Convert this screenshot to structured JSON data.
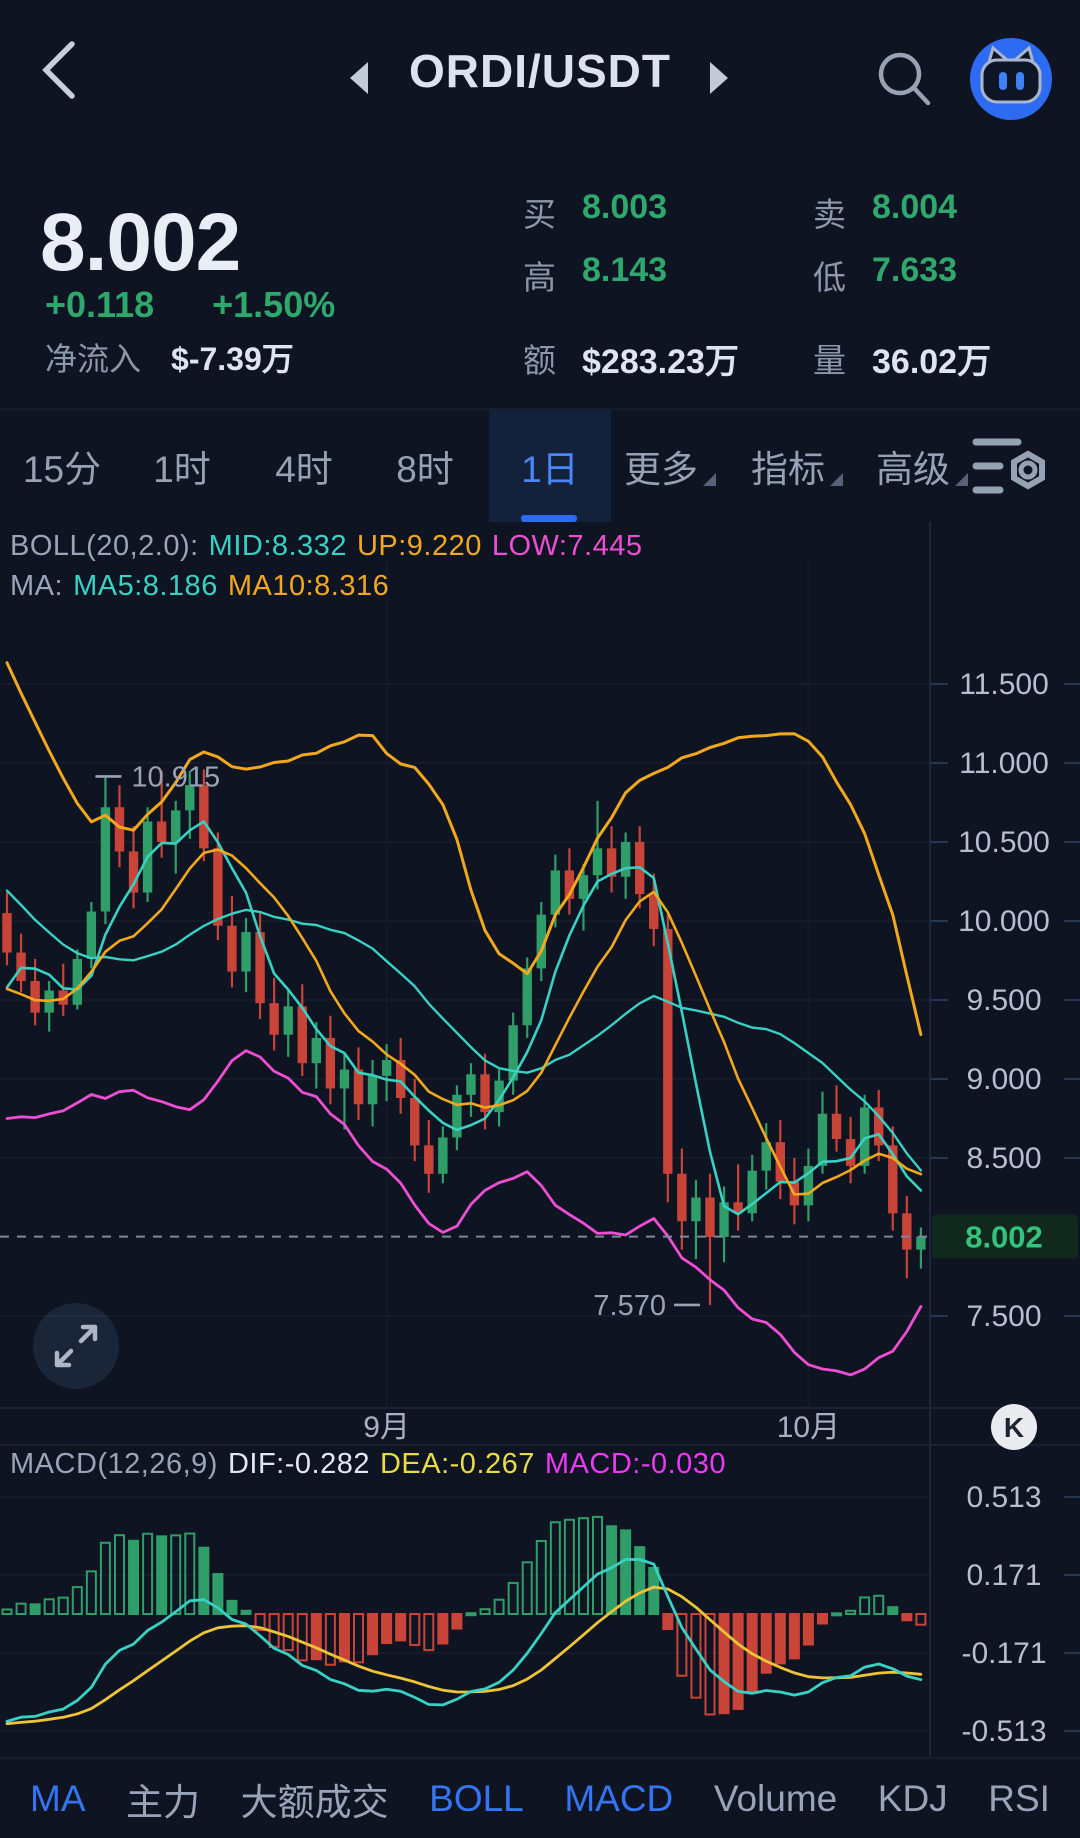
{
  "colors": {
    "bg": "#0e1422",
    "up_green": "#2f9e68",
    "down_red": "#c94438",
    "teal": "#38d1c3",
    "orange": "#f2a81d",
    "magenta": "#ee4fd2",
    "dea_yellow": "#e8db45",
    "dif_white": "#e3e8f2",
    "accent_blue": "#3574f2",
    "text_green": "#2fa86e",
    "axis_text": "#b6bed0",
    "grid": "#1a2332",
    "price_tag_bg": "#10291c",
    "price_tag_text": "#34c27c"
  },
  "header": {
    "title": "ORDI/USDT"
  },
  "quote": {
    "price": "8.002",
    "change": "+0.118",
    "change_pct": "+1.50%",
    "netflow_label": "净流入",
    "netflow_value": "$-7.39万",
    "stats": [
      {
        "label": "买",
        "value": "8.003"
      },
      {
        "label": "卖",
        "value": "8.004"
      },
      {
        "label": "高",
        "value": "8.143"
      },
      {
        "label": "低",
        "value": "7.633"
      },
      {
        "label": "额",
        "value": "$283.23万"
      },
      {
        "label": "量",
        "value": "36.02万"
      }
    ]
  },
  "tabs": {
    "items": [
      {
        "label": "15分"
      },
      {
        "label": "1时"
      },
      {
        "label": "4时"
      },
      {
        "label": "8时"
      },
      {
        "label": "1日",
        "selected": true
      },
      {
        "label": "更多",
        "dropdown": true
      },
      {
        "label": "指标",
        "dropdown": true
      },
      {
        "label": "高级",
        "dropdown": true
      }
    ]
  },
  "indicator_headers": {
    "boll": [
      {
        "text": "BOLL(20,2.0):",
        "color": "#9aa4b8"
      },
      {
        "text": "MID:8.332",
        "color": "#38d1c3"
      },
      {
        "text": "UP:9.220",
        "color": "#f2a81d"
      },
      {
        "text": "LOW:7.445",
        "color": "#ee4fd2"
      }
    ],
    "ma": [
      {
        "text": "MA:",
        "color": "#9aa4b8"
      },
      {
        "text": "MA5:8.186",
        "color": "#38d1c3"
      },
      {
        "text": "MA10:8.316",
        "color": "#f2a81d"
      }
    ],
    "macd": [
      {
        "text": "MACD(12,26,9)",
        "color": "#9aa4b8"
      },
      {
        "text": "DIF:-0.282",
        "color": "#e3e8f2"
      },
      {
        "text": "DEA:-0.267",
        "color": "#e8db45"
      },
      {
        "text": "MACD:-0.030",
        "color": "#ea3bf2"
      }
    ]
  },
  "chart_data": {
    "type": "candlestick",
    "symbol": "ORDI/USDT",
    "interval": "1日",
    "y_axis_labels": [
      {
        "price": 11.5,
        "label": "11.500"
      },
      {
        "price": 11.0,
        "label": "11.000"
      },
      {
        "price": 10.5,
        "label": "10.500"
      },
      {
        "price": 10.0,
        "label": "10.000"
      },
      {
        "price": 9.5,
        "label": "9.500"
      },
      {
        "price": 9.0,
        "label": "9.000"
      },
      {
        "price": 8.5,
        "label": "8.500"
      },
      {
        "price": 7.5,
        "label": "7.500"
      }
    ],
    "current_price": 8.002,
    "current_price_label": "8.002",
    "high_annotation": {
      "index": 7,
      "price": 10.915,
      "label": "10.915"
    },
    "low_annotation": {
      "index": 50,
      "price": 7.57,
      "label": "7.570"
    },
    "x_axis_labels": [
      {
        "label": "9月",
        "index": 27
      },
      {
        "label": "10月",
        "index": 57
      }
    ],
    "macd_axis_labels": [
      {
        "value": 0.513,
        "label": "0.513"
      },
      {
        "value": 0.171,
        "label": "0.171"
      },
      {
        "value": -0.171,
        "label": "-0.171"
      },
      {
        "value": -0.513,
        "label": "-0.513"
      }
    ],
    "macd_latest": {
      "dif": -0.282,
      "dea": -0.267,
      "macd": -0.03
    },
    "boll_latest": {
      "mid": 8.332,
      "up": 9.22,
      "low": 7.445
    },
    "ma_latest": {
      "ma5": 8.186,
      "ma10": 8.316
    },
    "prehistory_closes": [
      11.6,
      11.45,
      11.3,
      11.15,
      11.0,
      10.85,
      10.7,
      10.55,
      10.75,
      10.3,
      10.1,
      9.95,
      9.8,
      9.6,
      9.35,
      9.1,
      9.0,
      9.45,
      9.75,
      9.9
    ],
    "candles_ohlc": [
      [
        10.05,
        10.18,
        9.72,
        9.8
      ],
      [
        9.8,
        9.92,
        9.55,
        9.62
      ],
      [
        9.62,
        9.76,
        9.34,
        9.42
      ],
      [
        9.42,
        9.62,
        9.3,
        9.56
      ],
      [
        9.56,
        9.73,
        9.4,
        9.47
      ],
      [
        9.47,
        9.82,
        9.44,
        9.76
      ],
      [
        9.76,
        10.12,
        9.7,
        10.06
      ],
      [
        10.06,
        10.915,
        9.98,
        10.72
      ],
      [
        10.72,
        10.86,
        10.34,
        10.44
      ],
      [
        10.44,
        10.6,
        10.08,
        10.18
      ],
      [
        10.18,
        10.72,
        10.12,
        10.63
      ],
      [
        10.63,
        10.95,
        10.4,
        10.5
      ],
      [
        10.5,
        10.76,
        10.3,
        10.7
      ],
      [
        10.7,
        10.95,
        10.52,
        10.86
      ],
      [
        10.86,
        10.96,
        10.38,
        10.46
      ],
      [
        10.46,
        10.56,
        9.88,
        9.97
      ],
      [
        9.97,
        10.16,
        9.58,
        9.68
      ],
      [
        9.68,
        10.02,
        9.55,
        9.93
      ],
      [
        9.93,
        10.06,
        9.38,
        9.48
      ],
      [
        9.48,
        9.64,
        9.18,
        9.28
      ],
      [
        9.28,
        9.56,
        9.14,
        9.46
      ],
      [
        9.46,
        9.6,
        9.02,
        9.1
      ],
      [
        9.1,
        9.36,
        8.94,
        9.26
      ],
      [
        9.26,
        9.4,
        8.84,
        8.94
      ],
      [
        8.94,
        9.16,
        8.68,
        9.06
      ],
      [
        9.06,
        9.2,
        8.74,
        8.84
      ],
      [
        8.84,
        9.12,
        8.7,
        9.02
      ],
      [
        9.02,
        9.22,
        8.86,
        9.12
      ],
      [
        9.12,
        9.26,
        8.78,
        8.88
      ],
      [
        8.88,
        9.0,
        8.48,
        8.58
      ],
      [
        8.58,
        8.74,
        8.28,
        8.4
      ],
      [
        8.4,
        8.7,
        8.34,
        8.63
      ],
      [
        8.63,
        8.96,
        8.55,
        8.9
      ],
      [
        8.9,
        9.1,
        8.76,
        9.03
      ],
      [
        9.03,
        9.16,
        8.68,
        8.79
      ],
      [
        8.79,
        9.06,
        8.7,
        8.99
      ],
      [
        8.99,
        9.42,
        8.9,
        9.34
      ],
      [
        9.34,
        9.77,
        9.26,
        9.7
      ],
      [
        9.7,
        10.12,
        9.62,
        10.04
      ],
      [
        10.04,
        10.42,
        9.96,
        10.32
      ],
      [
        10.32,
        10.46,
        10.04,
        10.14
      ],
      [
        10.14,
        10.36,
        9.94,
        10.29
      ],
      [
        10.29,
        10.76,
        10.2,
        10.46
      ],
      [
        10.46,
        10.6,
        10.18,
        10.28
      ],
      [
        10.28,
        10.56,
        10.14,
        10.5
      ],
      [
        10.5,
        10.6,
        10.08,
        10.17
      ],
      [
        10.17,
        10.3,
        9.84,
        9.95
      ],
      [
        9.95,
        10.04,
        8.22,
        8.4
      ],
      [
        8.4,
        8.56,
        7.92,
        8.1
      ],
      [
        8.1,
        8.36,
        7.86,
        8.25
      ],
      [
        8.25,
        8.4,
        7.57,
        8.0
      ],
      [
        8.0,
        8.32,
        7.84,
        8.22
      ],
      [
        8.22,
        8.46,
        8.04,
        8.15
      ],
      [
        8.15,
        8.52,
        8.1,
        8.42
      ],
      [
        8.42,
        8.72,
        8.3,
        8.6
      ],
      [
        8.6,
        8.74,
        8.24,
        8.35
      ],
      [
        8.35,
        8.5,
        8.08,
        8.2
      ],
      [
        8.2,
        8.56,
        8.1,
        8.45
      ],
      [
        8.45,
        8.92,
        8.4,
        8.78
      ],
      [
        8.78,
        8.96,
        8.54,
        8.62
      ],
      [
        8.62,
        8.76,
        8.34,
        8.45
      ],
      [
        8.45,
        8.9,
        8.4,
        8.82
      ],
      [
        8.82,
        8.93,
        8.48,
        8.58
      ],
      [
        8.58,
        8.7,
        8.04,
        8.15
      ],
      [
        8.15,
        8.26,
        7.74,
        7.92
      ],
      [
        7.92,
        8.06,
        7.8,
        8.002
      ]
    ]
  },
  "bottom_nav": {
    "items": [
      {
        "label": "MA",
        "active": true
      },
      {
        "label": "主力"
      },
      {
        "label": "大额成交"
      },
      {
        "label": "BOLL",
        "active": true
      },
      {
        "label": "MACD",
        "active": true
      },
      {
        "label": "Volume"
      },
      {
        "label": "KDJ"
      },
      {
        "label": "RSI"
      }
    ]
  },
  "badges": {
    "k_badge": "K"
  }
}
